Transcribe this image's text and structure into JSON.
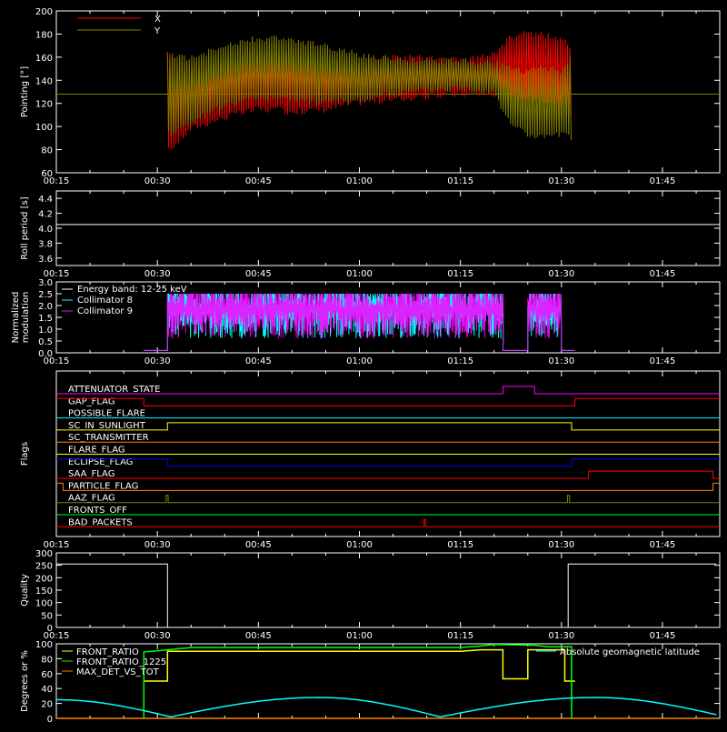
{
  "chart_data": [
    {
      "type": "line",
      "panel": "pointing",
      "ylabel": "Pointing [°]",
      "xlim": [
        "00:15",
        "01:53"
      ],
      "ylim": [
        60,
        200
      ],
      "yticks": [
        "60",
        "80",
        "100",
        "120",
        "140",
        "160",
        "180",
        "200"
      ],
      "xticks": [
        "00:15",
        "00:30",
        "00:45",
        "01:00",
        "01:15",
        "01:30",
        "01:45"
      ],
      "legend_position": "top-left",
      "reference_level": 128,
      "series": [
        {
          "name": "X",
          "color": "#ff0000",
          "t": [
            31.5,
            35,
            40,
            45,
            50,
            55,
            60,
            65,
            70,
            75,
            80,
            82,
            85,
            87,
            90,
            91.5
          ],
          "min": [
            75,
            95,
            105,
            112,
            110,
            112,
            118,
            120,
            123,
            125,
            125,
            120,
            122,
            118,
            110,
            105
          ],
          "max": [
            165,
            155,
            160,
            165,
            162,
            158,
            160,
            163,
            162,
            160,
            165,
            178,
            185,
            182,
            180,
            170
          ]
        },
        {
          "name": "Y",
          "color": "#808000",
          "t": [
            31.5,
            35,
            40,
            45,
            50,
            55,
            60,
            65,
            70,
            75,
            80,
            82,
            85,
            87,
            90,
            91.5
          ],
          "min": [
            90,
            100,
            115,
            122,
            120,
            118,
            120,
            125,
            128,
            130,
            128,
            102,
            90,
            88,
            90,
            88
          ],
          "max": [
            165,
            162,
            172,
            180,
            178,
            172,
            165,
            162,
            160,
            160,
            158,
            155,
            150,
            155,
            150,
            165
          ]
        }
      ]
    },
    {
      "type": "line",
      "panel": "roll_period",
      "ylabel": "Roll period [s]",
      "ylim": [
        3.5,
        4.5
      ],
      "yticks": [
        "3.6",
        "3.8",
        "4.0",
        "4.2",
        "4.4"
      ],
      "xticks": [
        "00:15",
        "00:30",
        "00:45",
        "01:00",
        "01:15",
        "01:30",
        "01:45"
      ],
      "series": [
        {
          "name": "",
          "color": "#ffffff",
          "t": [
            15,
            113
          ],
          "y": [
            4.05,
            4.05
          ]
        }
      ]
    },
    {
      "type": "line",
      "panel": "modulation",
      "ylabel": "Normalized modulation",
      "annotation": "Energy band: 12-25 keV",
      "ylim": [
        0.0,
        3.0
      ],
      "yticks": [
        "0.0",
        "0.5",
        "1.0",
        "1.5",
        "2.0",
        "2.5",
        "3.0"
      ],
      "xticks": [
        "00:15",
        "00:30",
        "00:45",
        "01:00",
        "01:15",
        "01:30",
        "01:45"
      ],
      "legend_position": "top-left",
      "series": [
        {
          "name": "Collimator 8",
          "color": "#00ffff",
          "segments": [
            [
              28,
              31.5,
              0.1
            ],
            [
              31.5,
              81.3,
              "noise"
            ],
            [
              81.3,
              85,
              0.1
            ],
            [
              85,
              90,
              "noise"
            ],
            [
              90,
              92,
              0.1
            ]
          ]
        },
        {
          "name": "Collimator 9",
          "color": "#ff00ff",
          "segments": [
            [
              28,
              31.5,
              0.1
            ],
            [
              31.5,
              81.3,
              "noise"
            ],
            [
              81.3,
              85,
              0.1
            ],
            [
              85,
              90,
              "noise"
            ],
            [
              90,
              92,
              0.1
            ]
          ]
        }
      ]
    },
    {
      "type": "line",
      "panel": "flags",
      "ylabel": "Flags",
      "xticks": [
        "00:15",
        "00:30",
        "00:45",
        "01:00",
        "01:15",
        "01:30",
        "01:45"
      ],
      "flags": [
        {
          "name": "ATTENUATOR_STATE",
          "color": "#ff00ff",
          "steps": [
            [
              15,
              0
            ],
            [
              81.3,
              1
            ],
            [
              86,
              0
            ]
          ]
        },
        {
          "name": "GAP_FLAG",
          "color": "#ff0000",
          "steps": [
            [
              15,
              1
            ],
            [
              28,
              0
            ],
            [
              92,
              1
            ]
          ]
        },
        {
          "name": "POSSIBLE_FLARE",
          "color": "#00ffff",
          "steps": [
            [
              15,
              0
            ]
          ]
        },
        {
          "name": "SC_IN_SUNLIGHT",
          "color": "#ffff00",
          "steps": [
            [
              15,
              0
            ],
            [
              31.5,
              1
            ],
            [
              91.5,
              0
            ]
          ]
        },
        {
          "name": "SC_TRANSMITTER",
          "color": "#ff8000",
          "steps": [
            [
              15,
              0
            ]
          ]
        },
        {
          "name": "FLARE_FLAG",
          "color": "#ffff00",
          "steps": [
            [
              15,
              0
            ]
          ]
        },
        {
          "name": "ECLIPSE_FLAG",
          "color": "#0000ff",
          "steps": [
            [
              15,
              1
            ],
            [
              31.5,
              0
            ],
            [
              91.5,
              1
            ]
          ]
        },
        {
          "name": "SAA_FLAG",
          "color": "#ff0000",
          "steps": [
            [
              15,
              0
            ],
            [
              94,
              1
            ],
            [
              112.5,
              0
            ]
          ]
        },
        {
          "name": "PARTICLE_FLAG",
          "color": "#ff8000",
          "steps": [
            [
              15,
              1
            ],
            [
              16,
              0
            ],
            [
              112.5,
              1
            ]
          ]
        },
        {
          "name": "AAZ_FLAG",
          "color": "#808000",
          "steps": [
            [
              15,
              0
            ],
            [
              31.3,
              1
            ],
            [
              31.6,
              0
            ],
            [
              90.9,
              1
            ],
            [
              91.2,
              0
            ]
          ]
        },
        {
          "name": "FRONTS_OFF",
          "color": "#00ff00",
          "steps": [
            [
              15,
              0
            ]
          ]
        },
        {
          "name": "BAD_PACKETS",
          "color": "#ff0000",
          "steps": [
            [
              15,
              0
            ],
            [
              69.6,
              1
            ],
            [
              69.8,
              0
            ]
          ]
        }
      ]
    },
    {
      "type": "line",
      "panel": "quality",
      "ylabel": "Quality",
      "ylim": [
        0,
        300
      ],
      "yticks": [
        "0",
        "50",
        "100",
        "150",
        "200",
        "250",
        "300"
      ],
      "xticks": [
        "00:15",
        "00:30",
        "00:45",
        "01:00",
        "01:15",
        "01:30",
        "01:45"
      ],
      "series": [
        {
          "name": "",
          "color": "#ffffff",
          "t": [
            15,
            31.5,
            31.5,
            91.0,
            91.0,
            113
          ],
          "y": [
            255,
            255,
            0,
            0,
            255,
            255
          ]
        }
      ]
    },
    {
      "type": "line",
      "panel": "ratios",
      "ylabel": "Degrees or %",
      "ylim": [
        0,
        100
      ],
      "yticks": [
        "0",
        "20",
        "40",
        "60",
        "80",
        "100"
      ],
      "xticks": [
        "00:15",
        "00:30",
        "00:45",
        "01:00",
        "01:15",
        "01:30",
        "01:45"
      ],
      "legend_position": "top-left",
      "series": [
        {
          "name": "FRONT_RATIO",
          "color": "#ffff00",
          "t": [
            28,
            31.5,
            31.5,
            75,
            78,
            81.3,
            81.3,
            85,
            85,
            90.5,
            90.5,
            92
          ],
          "y": [
            50,
            50,
            90,
            90,
            92,
            92,
            53,
            53,
            92,
            92,
            50,
            50
          ]
        },
        {
          "name": "FRONT_RATIO_1225",
          "color": "#00ff00",
          "t": [
            28,
            28,
            31.5,
            35,
            60,
            75,
            78,
            80,
            86,
            88,
            91.5,
            91.5
          ],
          "y": [
            0,
            89,
            92,
            95,
            95,
            95,
            97,
            99,
            98,
            96,
            96,
            0
          ]
        },
        {
          "name": "MAX_DET_VS_TOT",
          "color": "#ff8000",
          "t": [
            15,
            113
          ],
          "y": [
            0,
            0
          ]
        },
        {
          "name": "Absolute geomagnetic latitude",
          "color": "#00ffff",
          "t": [
            15,
            32,
            54,
            72,
            95,
            113
          ],
          "y": [
            25,
            2,
            28,
            2,
            28,
            5
          ]
        }
      ]
    }
  ]
}
